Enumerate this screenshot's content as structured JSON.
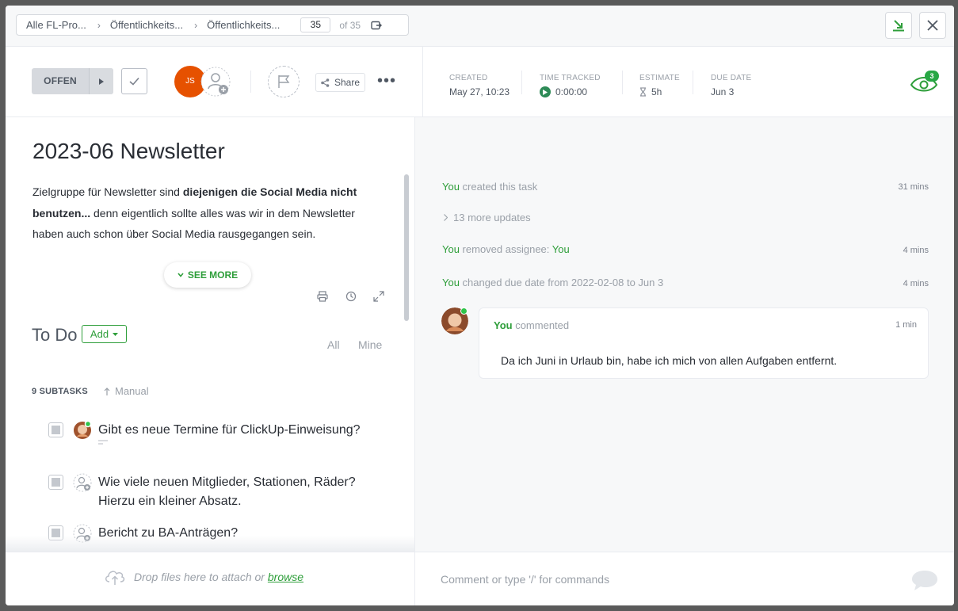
{
  "breadcrumb": {
    "items": [
      "Alle FL-Pro...",
      "Öffentlichkeits...",
      "Öffentlichkeits..."
    ],
    "page": "35",
    "total": "of 35"
  },
  "status": {
    "label": "OFFEN"
  },
  "assignee": {
    "initials": "JS"
  },
  "share_label": "Share",
  "meta": {
    "created_label": "CREATED",
    "created_value": "May 27, 10:23",
    "time_label": "TIME TRACKED",
    "time_value": "0:00:00",
    "estimate_label": "ESTIMATE",
    "estimate_value": "5h",
    "due_label": "DUE DATE",
    "due_value": "Jun 3"
  },
  "watchers_count": "3",
  "task": {
    "title": "2023-06 Newsletter",
    "desc_1": "Zielgruppe für Newsletter sind ",
    "desc_bold": "diejenigen die Social Media nicht benutzen...",
    "desc_2": " denn eigentlich sollte alles was wir in dem Newsletter haben auch schon über Social Media rausgegangen sein.",
    "see_more": "SEE MORE"
  },
  "todo": {
    "title": "To Do",
    "add_label": "Add",
    "filter_all": "All",
    "filter_mine": "Mine",
    "subtasks_count": "9 SUBTASKS",
    "sort_label": "Manual",
    "subtasks": [
      {
        "text": "Gibt es neue Termine für ClickUp-Einweisung?"
      },
      {
        "text": "Wie viele neuen Mitglieder, Stationen, Räder? Hierzu ein kleiner Absatz."
      },
      {
        "text": "Bericht zu BA-Anträgen?"
      }
    ]
  },
  "activity": {
    "items": [
      {
        "actor": "You",
        "action": " created this task",
        "time": "31 mins"
      },
      {
        "actor": "You",
        "action": " removed assignee: ",
        "target": "You",
        "time": "4 mins"
      },
      {
        "actor": "You",
        "action": " changed due date from 2022-02-08 to Jun 3",
        "time": "4 mins"
      }
    ],
    "more_updates": "13 more updates"
  },
  "comment": {
    "author": "You",
    "verb": " commented",
    "time": "1 min",
    "body": "Da ich Juni in Urlaub bin, habe ich mich von allen Aufgaben entfernt."
  },
  "footer": {
    "drop_text": "Drop files here to attach or ",
    "browse": "browse",
    "comment_placeholder": "Comment or type '/' for commands"
  },
  "colors": {
    "accent_green": "#2e9e3a",
    "assignee_orange": "#e65100"
  }
}
